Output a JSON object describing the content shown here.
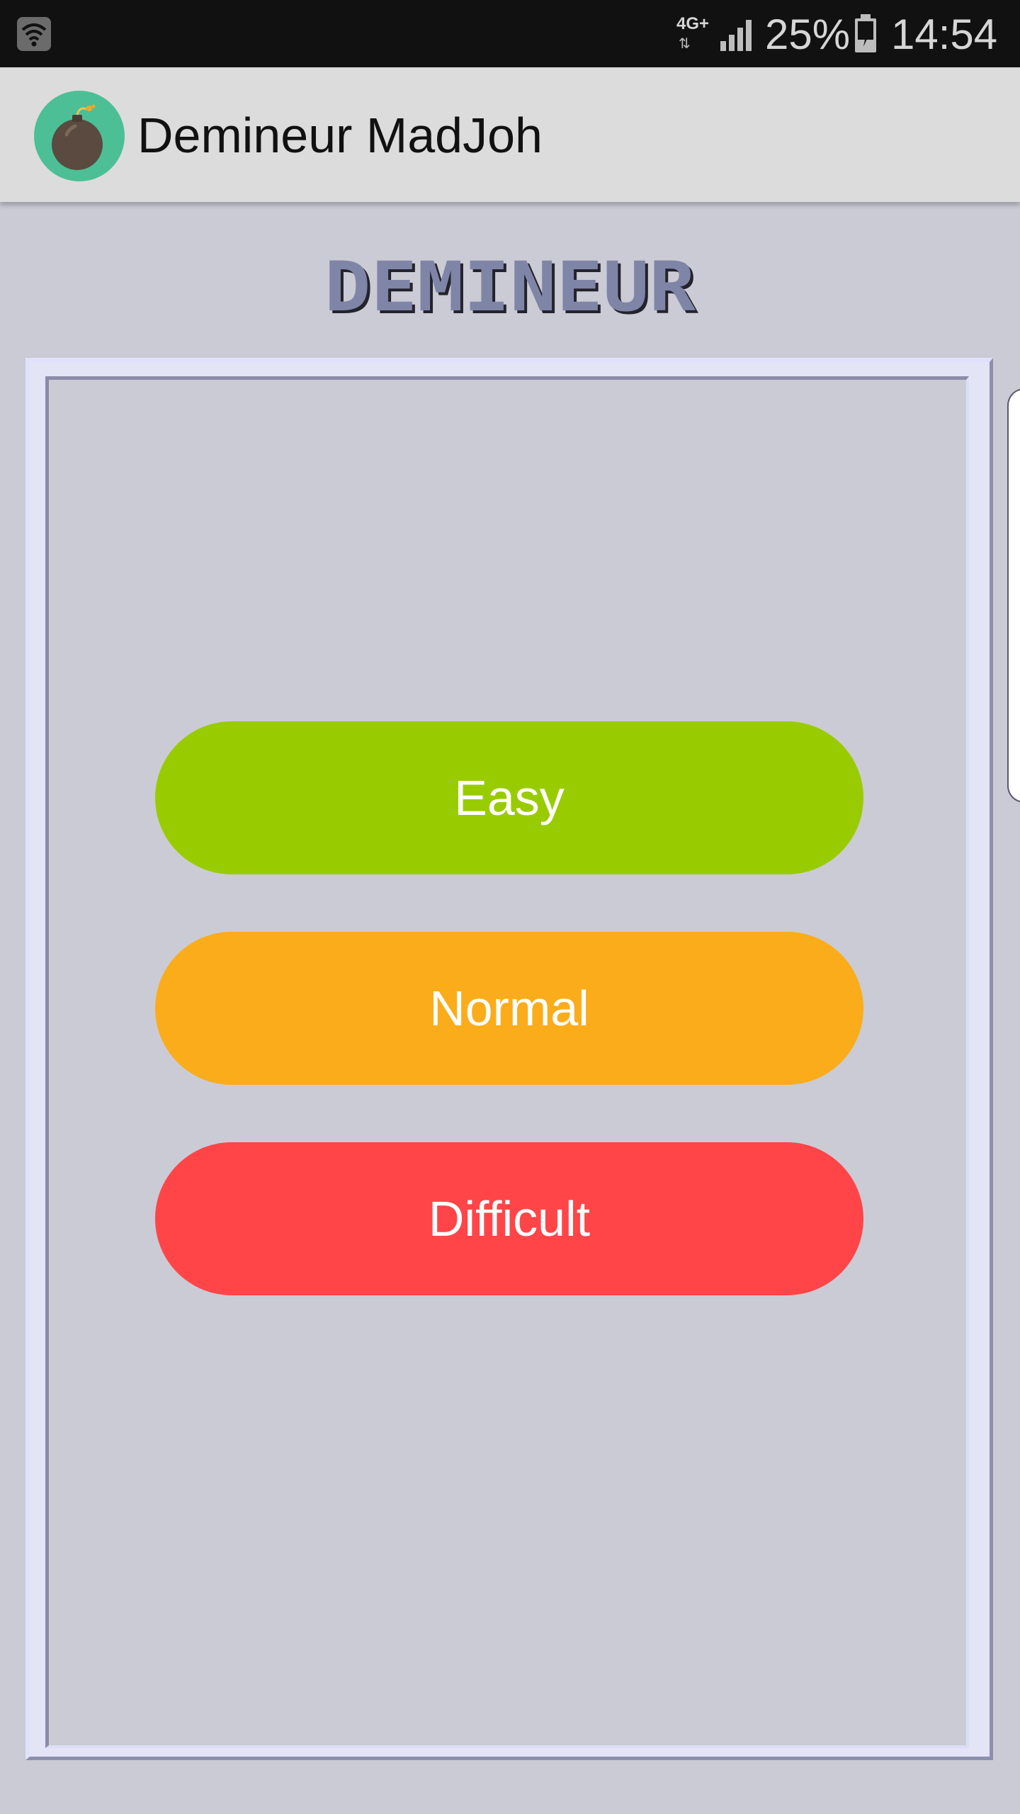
{
  "status_bar": {
    "wifi_icon": "wifi-icon",
    "network_type": "4G+",
    "network_arrows": "⇅",
    "signal_icon": "signal-icon",
    "battery_percent": "25%",
    "battery_icon": "battery-charging-icon",
    "time": "14:54"
  },
  "app_bar": {
    "icon": "bomb-icon",
    "title": "Demineur MadJoh"
  },
  "game": {
    "title": "DEMINEUR",
    "buttons": {
      "easy": "Easy",
      "normal": "Normal",
      "difficult": "Difficult"
    }
  },
  "colors": {
    "status_bar_bg": "#111111",
    "app_bar_bg": "#dcdcdc",
    "content_bg": "#cbcbd5",
    "app_icon_circle": "#4cbf97",
    "bomb": "#5b4a3f",
    "title_fill": "#7f85a7",
    "title_shadow": "#23232b",
    "easy": "#99cc00",
    "normal": "#fbac1a",
    "difficult": "#ff4548"
  }
}
